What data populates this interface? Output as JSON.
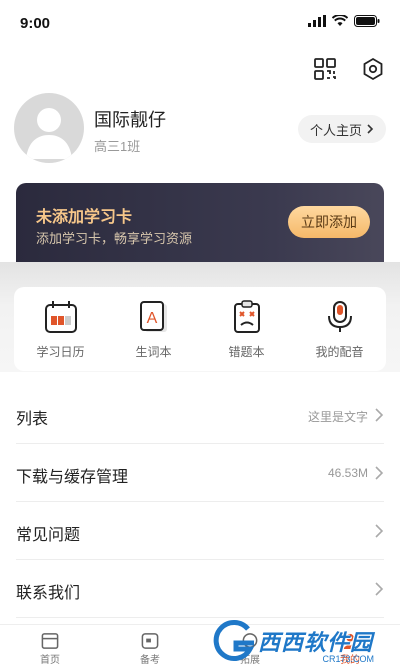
{
  "status": {
    "time": "9:00"
  },
  "profile": {
    "name": "国际靓仔",
    "class": "高三1班",
    "home_label": "个人主页"
  },
  "card": {
    "title": "未添加学习卡",
    "subtitle": "添加学习卡，畅享学习资源",
    "button": "立即添加"
  },
  "tools": [
    {
      "label": "学习日历",
      "icon": "calendar-icon"
    },
    {
      "label": "生词本",
      "icon": "word-book-icon"
    },
    {
      "label": "错题本",
      "icon": "wrong-answer-book-icon"
    },
    {
      "label": "我的配音",
      "icon": "microphone-icon"
    }
  ],
  "list": [
    {
      "label": "列表",
      "value": "这里是文字"
    },
    {
      "label": "下载与缓存管理",
      "value": "46.53M"
    },
    {
      "label": "常见问题",
      "value": ""
    },
    {
      "label": "联系我们",
      "value": ""
    }
  ],
  "tabs": [
    {
      "label": "首页",
      "icon": "home-icon"
    },
    {
      "label": "备考",
      "icon": "exam-prep-icon"
    },
    {
      "label": "拓展",
      "icon": "expand-icon"
    },
    {
      "label": "我的",
      "icon": "profile-icon",
      "active": true
    }
  ],
  "watermark": {
    "text": "西西软件园",
    "sub": "CR173.COM"
  },
  "colors": {
    "accent": "#e0552a",
    "card_bg": "#2b2a3d",
    "card_button": "#f5b869"
  }
}
